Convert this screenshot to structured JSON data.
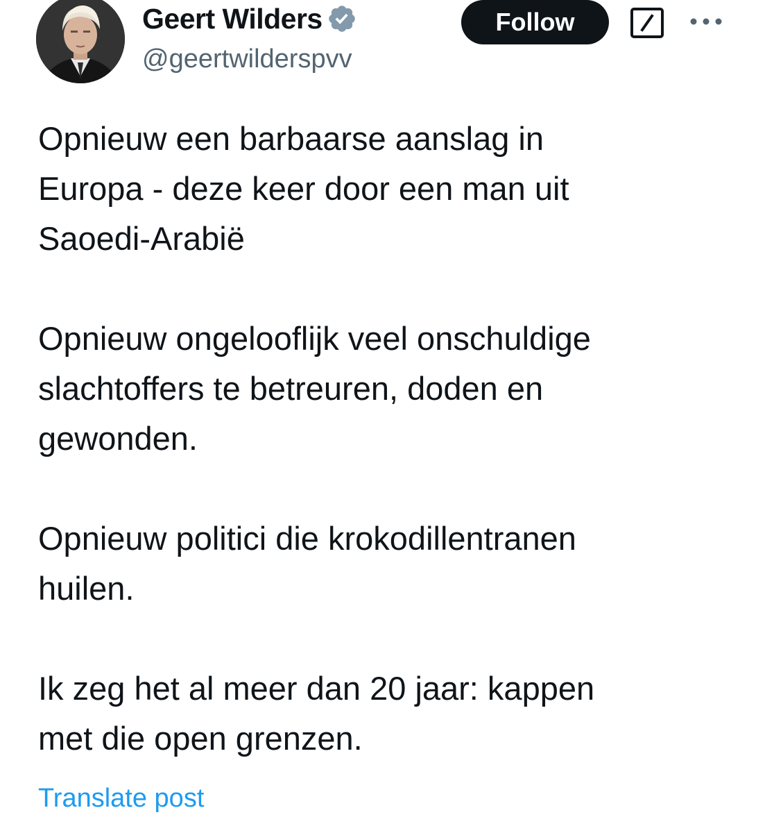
{
  "author": {
    "name": "Geert Wilders",
    "handle": "@geertwilderspvv",
    "verified_badge_color": "#829aab"
  },
  "actions": {
    "follow_label": "Follow",
    "grok_icon": "grok-icon",
    "more_icon": "more-options-icon"
  },
  "post": {
    "paragraphs": [
      "Opnieuw een barbaarse aanslag in\nEuropa - deze keer door een man uit\nSaoedi-Arabië",
      "Opnieuw ongelooflijk veel onschuldige\nslachtoffers te betreuren, doden en\ngewonden.",
      "Opnieuw politici die krokodillentranen\nhuilen.",
      "Ik zeg het al meer dan 20  jaar: kappen\nmet die open grenzen."
    ],
    "translate_label": "Translate post"
  },
  "colors": {
    "text": "#0f1419",
    "secondary": "#536471",
    "link": "#1d9bf0",
    "button_bg": "#0f1419"
  }
}
